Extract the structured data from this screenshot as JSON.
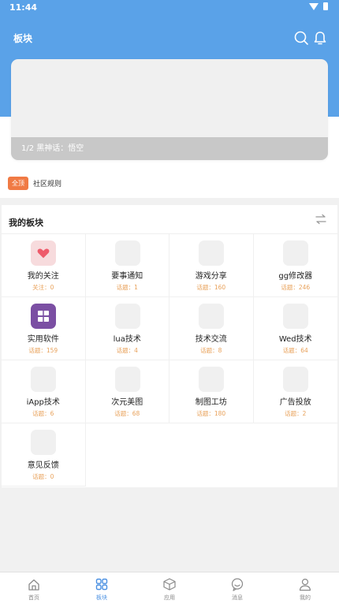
{
  "status": {
    "time": "11:44"
  },
  "header": {
    "title": "板块"
  },
  "banner": {
    "caption": "1/2 黑神话：悟空"
  },
  "notice": {
    "badge": "全顶",
    "text": "社区规则"
  },
  "section": {
    "title": "我的板块"
  },
  "boards": [
    {
      "name": "我的关注",
      "stat": "关注：0",
      "icon": "heart-icon"
    },
    {
      "name": "要事通知",
      "stat": "话题：1",
      "icon": "placeholder-icon"
    },
    {
      "name": "游戏分享",
      "stat": "话题：160",
      "icon": "placeholder-icon"
    },
    {
      "name": "gg修改器",
      "stat": "话题：246",
      "icon": "placeholder-icon"
    },
    {
      "name": "实用软件",
      "stat": "话题：159",
      "icon": "box-icon"
    },
    {
      "name": "lua技术",
      "stat": "话题：4",
      "icon": "placeholder-icon"
    },
    {
      "name": "技术交流",
      "stat": "话题：8",
      "icon": "placeholder-icon"
    },
    {
      "name": "Wed技术",
      "stat": "话题：64",
      "icon": "placeholder-icon"
    },
    {
      "name": "iApp技术",
      "stat": "话题：6",
      "icon": "placeholder-icon"
    },
    {
      "name": "次元美图",
      "stat": "话题：68",
      "icon": "placeholder-icon"
    },
    {
      "name": "制图工坊",
      "stat": "话题：180",
      "icon": "placeholder-icon"
    },
    {
      "name": "广告投放",
      "stat": "话题：2",
      "icon": "placeholder-icon"
    },
    {
      "name": "意见反馈",
      "stat": "话题：0",
      "icon": "placeholder-icon"
    }
  ],
  "tabs": [
    {
      "label": "首页",
      "icon": "home-icon",
      "active": false
    },
    {
      "label": "板块",
      "icon": "grid-icon",
      "active": true
    },
    {
      "label": "应用",
      "icon": "cube-icon",
      "active": false
    },
    {
      "label": "消息",
      "icon": "chat-icon",
      "active": false
    },
    {
      "label": "我的",
      "icon": "user-icon",
      "active": false
    }
  ],
  "colors": {
    "primary": "#5aa2e8",
    "active_tab": "#4a90e2",
    "stat": "#e8a15a",
    "badge": "#f07a44"
  }
}
